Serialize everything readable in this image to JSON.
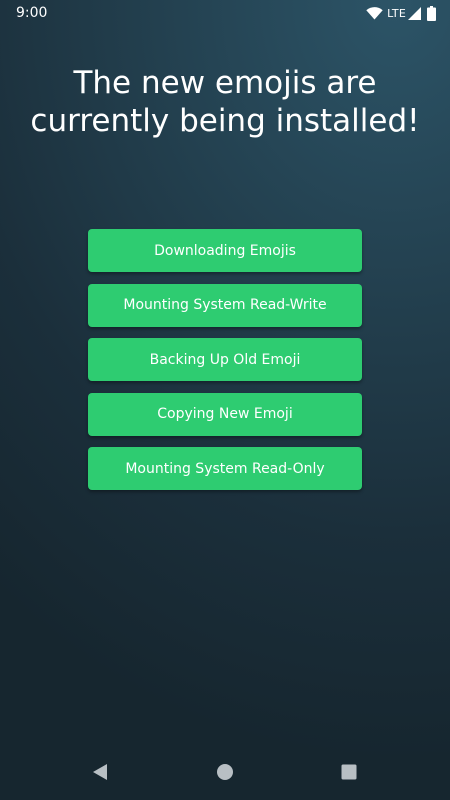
{
  "status_bar": {
    "time": "9:00",
    "network_label": "LTE",
    "icons": [
      "wifi-icon",
      "cell-signal-icon",
      "battery-icon"
    ]
  },
  "title": {
    "line1": "The new emojis are",
    "line2": "currently being installed!"
  },
  "steps": [
    {
      "label": "Downloading Emojis"
    },
    {
      "label": "Mounting System Read-Write"
    },
    {
      "label": "Backing Up Old Emoji"
    },
    {
      "label": "Copying New Emoji"
    },
    {
      "label": "Mounting System Read-Only"
    }
  ],
  "nav_bar": {
    "icons": [
      "back-icon",
      "home-icon",
      "recents-icon"
    ]
  },
  "colors": {
    "button": "#2ecc71",
    "background_top": "#2c5467",
    "background_bottom": "#16262f",
    "text": "#ffffff",
    "nav_icon": "#b8bfc4"
  }
}
